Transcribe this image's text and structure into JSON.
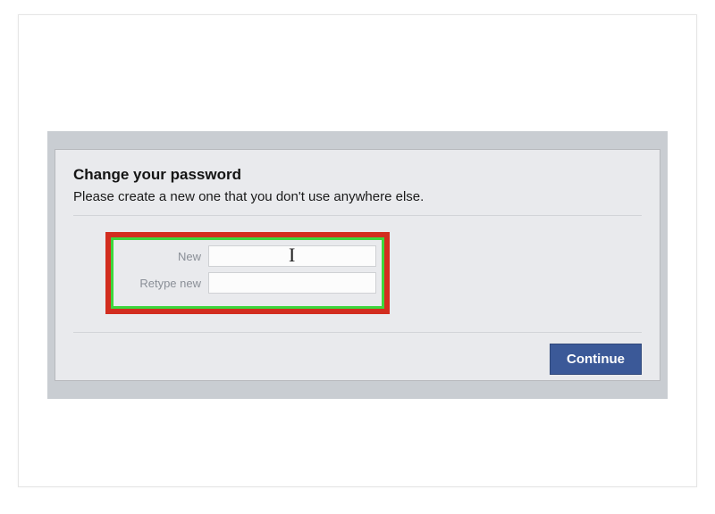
{
  "dialog": {
    "title": "Change your password",
    "subtitle": "Please create a new one that you don't use anywhere else.",
    "new_label": "New",
    "retype_label": "Retype new",
    "continue_label": "Continue"
  }
}
